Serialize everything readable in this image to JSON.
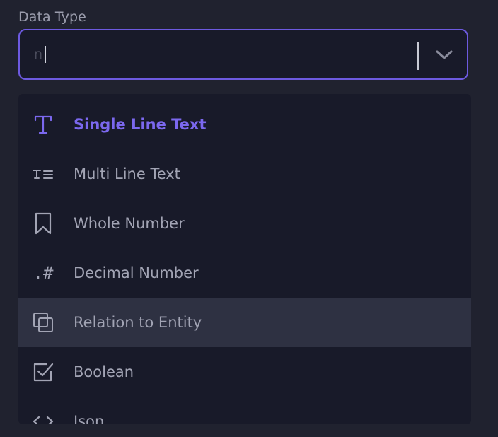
{
  "field": {
    "label": "Data Type",
    "input_value": "n"
  },
  "options": [
    {
      "label": "Single Line Text",
      "icon": "text-t-icon",
      "selected": true
    },
    {
      "label": "Multi Line Text",
      "icon": "multiline-text-icon"
    },
    {
      "label": "Whole Number",
      "icon": "bookmark-icon"
    },
    {
      "label": "Decimal Number",
      "icon": "decimal-hash-icon",
      "glyph": ".#"
    },
    {
      "label": "Relation to Entity",
      "icon": "copy-squares-icon",
      "highlighted": true
    },
    {
      "label": "Boolean",
      "icon": "checkbox-icon"
    },
    {
      "label": "Json",
      "icon": "code-brackets-icon"
    }
  ],
  "colors": {
    "accent": "#7b68ee",
    "border": "#6d5ae0",
    "background": "#20222f",
    "panel": "#181a29",
    "highlight": "#2e3142",
    "text": "#a2a4b4"
  }
}
